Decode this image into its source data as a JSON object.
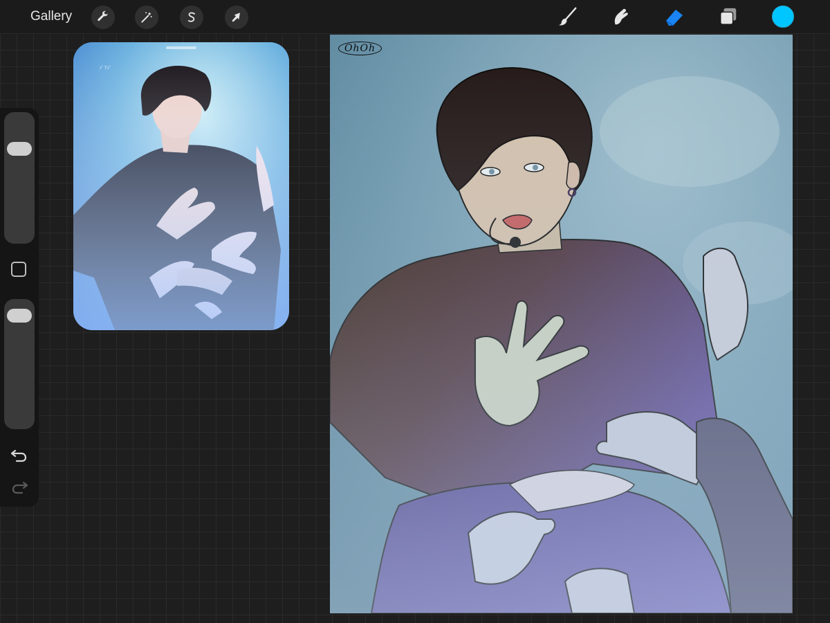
{
  "topbar": {
    "gallery_label": "Gallery",
    "left_tools": [
      {
        "name": "actions",
        "icon": "wrench-icon"
      },
      {
        "name": "adjustments",
        "icon": "magic-wand-icon"
      },
      {
        "name": "selection",
        "icon": "selection-s-icon"
      },
      {
        "name": "transform",
        "icon": "arrow-cursor-icon"
      }
    ],
    "right_tools": [
      {
        "name": "brush",
        "icon": "brush-icon"
      },
      {
        "name": "smudge",
        "icon": "smudge-finger-icon"
      },
      {
        "name": "eraser",
        "icon": "eraser-icon",
        "active": true
      },
      {
        "name": "layers",
        "icon": "layers-icon"
      }
    ],
    "current_color": "#00c6ff",
    "active_tool_color": "#1a84f5"
  },
  "sidebar": {
    "brush_size_level": 0.24,
    "opacity_level": 0.07,
    "icons": [
      "square-modify-icon",
      "undo-icon",
      "redo-icon"
    ]
  },
  "reference": {
    "watermark": "ｼﾞﾗｼﾞ"
  },
  "canvas": {
    "signature": "OhOh"
  }
}
